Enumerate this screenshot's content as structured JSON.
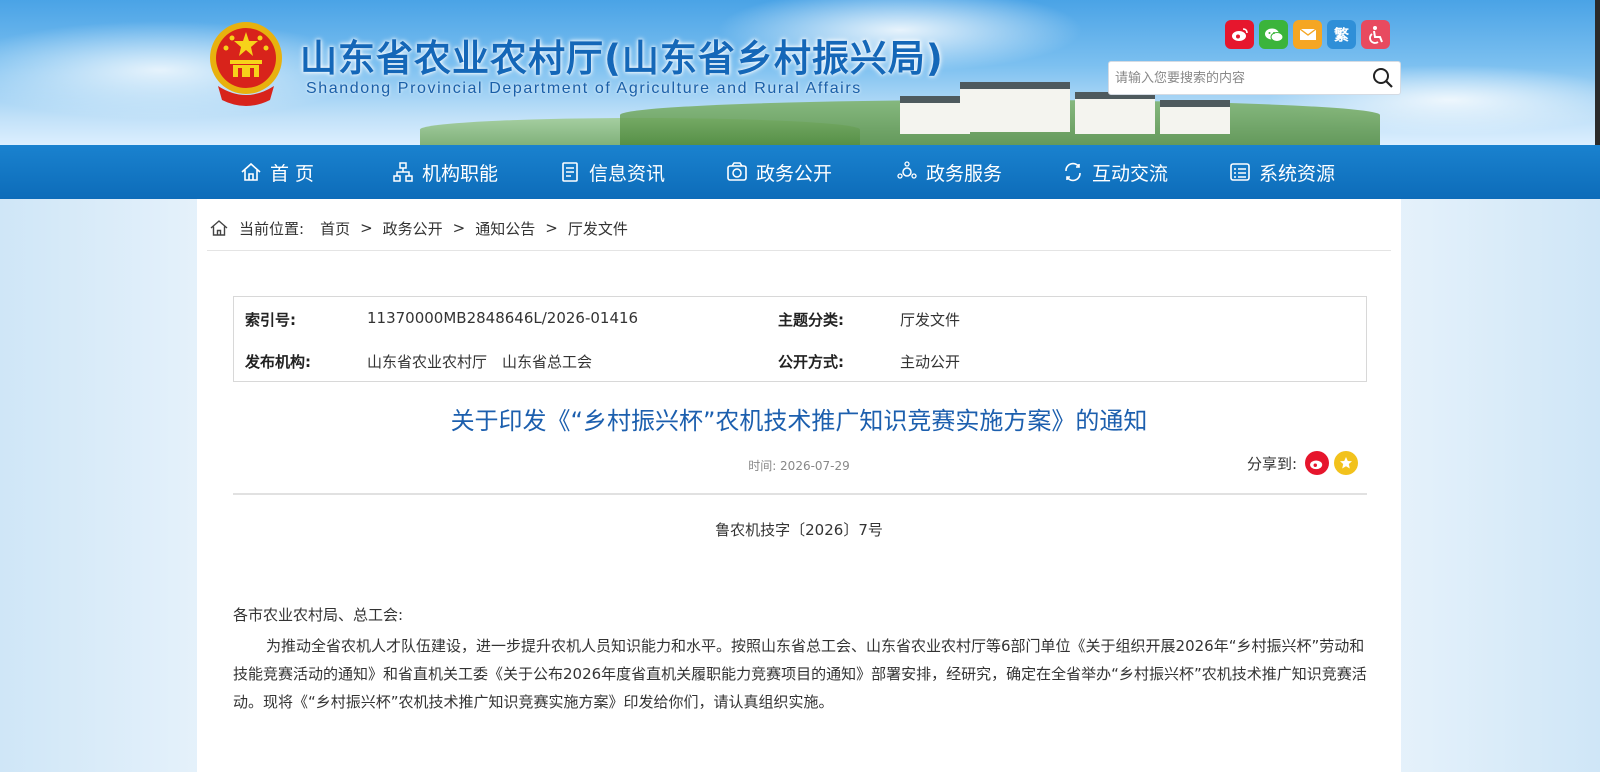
{
  "header": {
    "title": "山东省农业农村厅(山东省乡村振兴局)",
    "subtitle": "Shandong Provincial Department of Agriculture and Rural Affairs",
    "tools": [
      {
        "name": "weibo-icon",
        "label": "",
        "color": "#e6162d"
      },
      {
        "name": "wechat-icon",
        "label": "",
        "color": "#3bb43b"
      },
      {
        "name": "mail-icon",
        "label": "",
        "color": "#f5a623"
      },
      {
        "name": "traditional-chinese-icon",
        "label": "繁",
        "color": "#2f8fd8"
      },
      {
        "name": "accessibility-icon",
        "label": "",
        "color": "#e84a5f"
      }
    ],
    "search_placeholder": "请输入您要搜索的内容"
  },
  "nav": {
    "items": [
      {
        "label": "首 页",
        "icon": "home-icon"
      },
      {
        "label": "机构职能",
        "icon": "org-chart-icon"
      },
      {
        "label": "信息资讯",
        "icon": "document-icon"
      },
      {
        "label": "政务公开",
        "icon": "open-box-icon"
      },
      {
        "label": "政务服务",
        "icon": "service-icon"
      },
      {
        "label": "互动交流",
        "icon": "interaction-icon"
      },
      {
        "label": "系统资源",
        "icon": "resource-icon"
      }
    ]
  },
  "breadcrumb": {
    "prefix": "当前位置:",
    "items": [
      "首页",
      "政务公开",
      "通知公告",
      "厅发文件"
    ],
    "separator": ">"
  },
  "meta": {
    "index_label": "索引号:",
    "index_value": "11370000MB2848646L/2026-01416",
    "category_label": "主题分类:",
    "category_value": "厅发文件",
    "publisher_label": "发布机构:",
    "publisher_value": "山东省农业农村厅　山东省总工会",
    "disclosure_label": "公开方式:",
    "disclosure_value": "主动公开"
  },
  "article": {
    "title": "关于印发《“乡村振兴杯”农机技术推广知识竞赛实施方案》的通知",
    "time": "时间: 2026-07-29",
    "share_label": "分享到:",
    "doc_number": "鲁农机技字〔2026〕7号",
    "salutation": "各市农业农村局、总工会:",
    "paragraph": "为推动全省农机人才队伍建设，进一步提升农机人员知识能力和水平。按照山东省总工会、山东省农业农村厅等6部门单位《关于组织开展2026年“乡村振兴杯”劳动和技能竞赛活动的通知》和省直机关工委《关于公布2026年度省直机关履职能力竞赛项目的通知》部署安排，经研究，确定在全省举办“乡村振兴杯”农机技术推广知识竞赛活动。现将《“乡村振兴杯”农机技术推广知识竞赛实施方案》印发给你们，请认真组织实施。"
  },
  "colors": {
    "nav_bg": "#0d6cb9",
    "title_blue": "#1c5fae"
  }
}
